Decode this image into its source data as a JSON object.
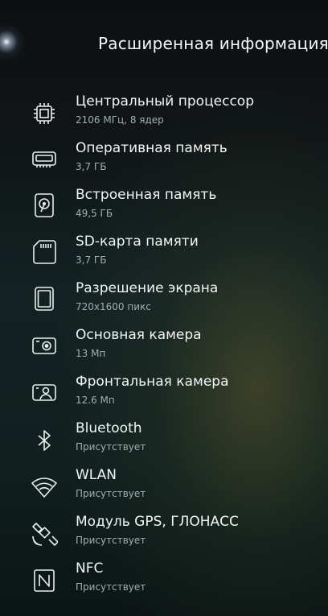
{
  "header": {
    "title": "Расширенная информация"
  },
  "items": [
    {
      "label": "Центральный процессор",
      "value": "2106 МГц, 8 ядер",
      "icon": "cpu-icon"
    },
    {
      "label": "Оперативная память",
      "value": "3,7 ГБ",
      "icon": "ram-icon"
    },
    {
      "label": "Встроенная память",
      "value": "49,5 ГБ",
      "icon": "storage-icon"
    },
    {
      "label": "SD-карта памяти",
      "value": "3,7 ГБ",
      "icon": "sd-card-icon"
    },
    {
      "label": "Разрешение экрана",
      "value": "720x1600 пикс",
      "icon": "screen-icon"
    },
    {
      "label": "Основная камера",
      "value": "13 Мп",
      "icon": "camera-icon"
    },
    {
      "label": "Фронтальная камера",
      "value": "12.6 Мп",
      "icon": "front-camera-icon"
    },
    {
      "label": "Bluetooth",
      "value": "Присутствует",
      "icon": "bluetooth-icon"
    },
    {
      "label": "WLAN",
      "value": "Присутствует",
      "icon": "wifi-icon"
    },
    {
      "label": "Модуль GPS, ГЛОНАСС",
      "value": "Присутствует",
      "icon": "satellite-icon"
    },
    {
      "label": "NFC",
      "value": "Присутствует",
      "icon": "nfc-icon"
    }
  ]
}
